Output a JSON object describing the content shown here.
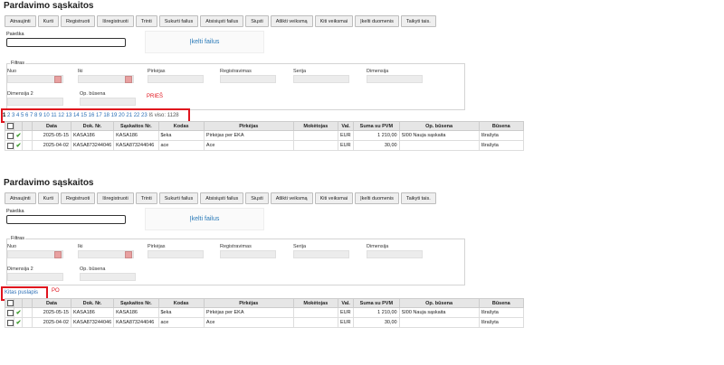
{
  "title": "Pardavimo sąskaitos",
  "toolbar": [
    "Atnaujinti",
    "Kurti",
    "Registruoti",
    "Išregistruoti",
    "Trinti",
    "Sukurti failus",
    "Atsisiųsti failus",
    "Siųsti",
    "Atlikti veiksmą",
    "Kiti veiksmai",
    "Įkelti duomenis",
    "Taikyti tais."
  ],
  "search_label": "Paieška",
  "upload_label": "Įkelti failus",
  "filter": {
    "legend": "Filtras",
    "nuo": "Nuo",
    "iki": "Iki",
    "pirkejas": "Pirkėjas",
    "registravimas": "Registravimas",
    "serija": "Serija",
    "dimensija": "Dimensija",
    "dimensija2": "Dimensija 2",
    "op_busena": "Op. būsena"
  },
  "before": {
    "tag": "PRIEŠ",
    "current_page": "1",
    "pages": "2 3 4 5 6 7 8 9 10 11 12 13 14 15 16 17 18 19 20 21 22 23",
    "total": "Iš viso: 1128"
  },
  "after": {
    "tag": "PO",
    "next_label": "Kitas puslapis"
  },
  "columns": [
    "Data",
    "Dok. Nr.",
    "Sąskaitos Nr.",
    "Kodas",
    "Pirkėjas",
    "Mokėtojas",
    "Val.",
    "Suma su PVM",
    "Op. būsena",
    "Būsena"
  ],
  "rows": [
    {
      "data": "2025-05-15",
      "dok": "KASA186",
      "sask": "KASA186",
      "kodas": "$eka",
      "pirkejas": "Pirkėjas per EKA",
      "moketojas": "",
      "val": "EUR",
      "suma": "1 210,00",
      "op": "SI00 Nauja sąskaita",
      "busena": "Išrašyta"
    },
    {
      "data": "2025-04-02",
      "dok": "KASA873244046",
      "sask": "KASA873244046",
      "kodas": "ace",
      "pirkejas": "Ace",
      "moketojas": "",
      "val": "EUR",
      "suma": "30,00",
      "op": "",
      "busena": "Išrašyta"
    }
  ]
}
